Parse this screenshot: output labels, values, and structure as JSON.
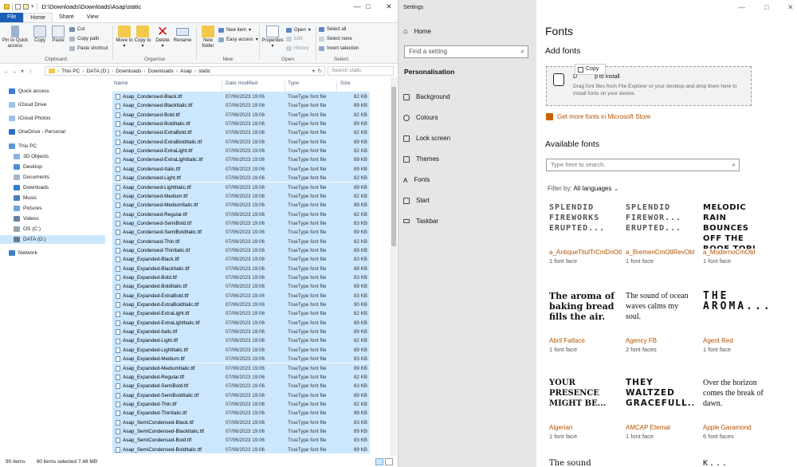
{
  "explorer": {
    "title": "D:\\Downloads\\Downloads\\Asap\\static",
    "tabs": [
      "File",
      "Home",
      "Share",
      "View"
    ],
    "ribbon": {
      "clipboard": {
        "label": "Clipboard",
        "pin": "Pin to Quick access",
        "copy": "Copy",
        "paste": "Paste",
        "cut": "Cut",
        "copy_path": "Copy path",
        "paste_shortcut": "Paste shortcut"
      },
      "organise": {
        "label": "Organise",
        "move_to": "Move to",
        "copy_to": "Copy to",
        "delete": "Delete",
        "rename": "Rename"
      },
      "new": {
        "label": "New",
        "new_folder": "New folder",
        "new_item": "New item",
        "easy_access": "Easy access"
      },
      "open": {
        "label": "Open",
        "properties": "Properties",
        "open": "Open",
        "edit": "Edit",
        "history": "History"
      },
      "select": {
        "label": "Select",
        "select_all": "Select all",
        "select_none": "Select none",
        "invert": "Invert selection"
      }
    },
    "breadcrumb": [
      "This PC",
      "DATA (D:)",
      "Downloads",
      "Downloads",
      "Asap",
      "static"
    ],
    "search_placeholder": "Search static",
    "nav": [
      "Quick access",
      "iCloud Drive",
      "iCloud Photos",
      "OneDrive - Personal",
      "This PC",
      "3D Objects",
      "Desktop",
      "Documents",
      "Downloads",
      "Music",
      "Pictures",
      "Videos",
      "OS (C:)",
      "DATA (D:)",
      "Network"
    ],
    "columns": {
      "name": "Name",
      "date": "Date modified",
      "type": "Type",
      "size": "Size"
    },
    "files": [
      {
        "name": "Asap_Condensed-Black.ttf",
        "date": "07/06/2023 19:06",
        "type": "TrueType font file",
        "size": "82 KB"
      },
      {
        "name": "Asap_Condensed-BlackItalic.ttf",
        "date": "07/06/2023 19:06",
        "type": "TrueType font file",
        "size": "89 KB"
      },
      {
        "name": "Asap_Condensed-Bold.ttf",
        "date": "07/06/2023 19:06",
        "type": "TrueType font file",
        "size": "82 KB"
      },
      {
        "name": "Asap_Condensed-BoldItalic.ttf",
        "date": "07/06/2023 19:06",
        "type": "TrueType font file",
        "size": "89 KB"
      },
      {
        "name": "Asap_Condensed-ExtraBold.ttf",
        "date": "07/06/2023 19:06",
        "type": "TrueType font file",
        "size": "82 KB"
      },
      {
        "name": "Asap_Condensed-ExtraBoldItalic.ttf",
        "date": "07/06/2023 19:06",
        "type": "TrueType font file",
        "size": "89 KB"
      },
      {
        "name": "Asap_Condensed-ExtraLight.ttf",
        "date": "07/06/2023 19:06",
        "type": "TrueType font file",
        "size": "82 KB"
      },
      {
        "name": "Asap_Condensed-ExtraLightItalic.ttf",
        "date": "07/06/2023 19:06",
        "type": "TrueType font file",
        "size": "89 KB"
      },
      {
        "name": "Asap_Condensed-Italic.ttf",
        "date": "07/06/2023 19:06",
        "type": "TrueType font file",
        "size": "89 KB"
      },
      {
        "name": "Asap_Condensed-Light.ttf",
        "date": "07/06/2023 19:06",
        "type": "TrueType font file",
        "size": "82 KB"
      },
      {
        "name": "Asap_Condensed-LightItalic.ttf",
        "date": "07/06/2023 19:06",
        "type": "TrueType font file",
        "size": "89 KB"
      },
      {
        "name": "Asap_Condensed-Medium.ttf",
        "date": "07/06/2023 19:06",
        "type": "TrueType font file",
        "size": "82 KB"
      },
      {
        "name": "Asap_Condensed-MediumItalic.ttf",
        "date": "07/06/2023 19:06",
        "type": "TrueType font file",
        "size": "89 KB"
      },
      {
        "name": "Asap_Condensed-Regular.ttf",
        "date": "07/06/2023 19:06",
        "type": "TrueType font file",
        "size": "82 KB"
      },
      {
        "name": "Asap_Condensed-SemiBold.ttf",
        "date": "07/06/2023 19:06",
        "type": "TrueType font file",
        "size": "83 KB"
      },
      {
        "name": "Asap_Condensed-SemiBoldItalic.ttf",
        "date": "07/06/2023 19:06",
        "type": "TrueType font file",
        "size": "89 KB"
      },
      {
        "name": "Asap_Condensed-Thin.ttf",
        "date": "07/06/2023 19:06",
        "type": "TrueType font file",
        "size": "82 KB"
      },
      {
        "name": "Asap_Condensed-ThinItalic.ttf",
        "date": "07/06/2023 19:06",
        "type": "TrueType font file",
        "size": "89 KB"
      },
      {
        "name": "Asap_Expanded-Black.ttf",
        "date": "07/06/2023 19:06",
        "type": "TrueType font file",
        "size": "83 KB"
      },
      {
        "name": "Asap_Expanded-BlackItalic.ttf",
        "date": "07/06/2023 19:06",
        "type": "TrueType font file",
        "size": "89 KB"
      },
      {
        "name": "Asap_Expanded-Bold.ttf",
        "date": "07/06/2023 19:06",
        "type": "TrueType font file",
        "size": "83 KB"
      },
      {
        "name": "Asap_Expanded-BoldItalic.ttf",
        "date": "07/06/2023 19:06",
        "type": "TrueType font file",
        "size": "89 KB"
      },
      {
        "name": "Asap_Expanded-ExtraBold.ttf",
        "date": "07/06/2023 19:06",
        "type": "TrueType font file",
        "size": "83 KB"
      },
      {
        "name": "Asap_Expanded-ExtraBoldItalic.ttf",
        "date": "07/06/2023 19:06",
        "type": "TrueType font file",
        "size": "90 KB"
      },
      {
        "name": "Asap_Expanded-ExtraLight.ttf",
        "date": "07/06/2023 19:06",
        "type": "TrueType font file",
        "size": "82 KB"
      },
      {
        "name": "Asap_Expanded-ExtraLightItalic.ttf",
        "date": "07/06/2023 19:06",
        "type": "TrueType font file",
        "size": "89 KB"
      },
      {
        "name": "Asap_Expanded-Italic.ttf",
        "date": "07/06/2023 19:06",
        "type": "TrueType font file",
        "size": "89 KB"
      },
      {
        "name": "Asap_Expanded-Light.ttf",
        "date": "07/06/2023 19:06",
        "type": "TrueType font file",
        "size": "82 KB"
      },
      {
        "name": "Asap_Expanded-LightItalic.ttf",
        "date": "07/06/2023 19:06",
        "type": "TrueType font file",
        "size": "89 KB"
      },
      {
        "name": "Asap_Expanded-Medium.ttf",
        "date": "07/06/2023 19:06",
        "type": "TrueType font file",
        "size": "83 KB"
      },
      {
        "name": "Asap_Expanded-MediumItalic.ttf",
        "date": "07/06/2023 19:06",
        "type": "TrueType font file",
        "size": "89 KB"
      },
      {
        "name": "Asap_Expanded-Regular.ttf",
        "date": "07/06/2023 19:06",
        "type": "TrueType font file",
        "size": "82 KB"
      },
      {
        "name": "Asap_Expanded-SemiBold.ttf",
        "date": "07/06/2023 19:06",
        "type": "TrueType font file",
        "size": "83 KB"
      },
      {
        "name": "Asap_Expanded-SemiBoldItalic.ttf",
        "date": "07/06/2023 19:06",
        "type": "TrueType font file",
        "size": "89 KB"
      },
      {
        "name": "Asap_Expanded-Thin.ttf",
        "date": "07/06/2023 19:06",
        "type": "TrueType font file",
        "size": "82 KB"
      },
      {
        "name": "Asap_Expanded-ThinItalic.ttf",
        "date": "07/06/2023 19:06",
        "type": "TrueType font file",
        "size": "89 KB"
      },
      {
        "name": "Asap_SemiCondensed-Black.ttf",
        "date": "07/06/2023 19:06",
        "type": "TrueType font file",
        "size": "83 KB"
      },
      {
        "name": "Asap_SemiCondensed-BlackItalic.ttf",
        "date": "07/06/2023 19:06",
        "type": "TrueType font file",
        "size": "89 KB"
      },
      {
        "name": "Asap_SemiCondensed-Bold.ttf",
        "date": "07/06/2023 19:06",
        "type": "TrueType font file",
        "size": "83 KB"
      },
      {
        "name": "Asap_SemiCondensed-BoldItalic.ttf",
        "date": "07/06/2023 19:06",
        "type": "TrueType font file",
        "size": "89 KB"
      }
    ],
    "status": {
      "count": "90 items",
      "selected": "90 items selected  7.48 MB"
    }
  },
  "settings": {
    "window_title": "Settings",
    "home": "Home",
    "search_placeholder": "Find a setting",
    "section": "Personalisation",
    "nav": [
      "Background",
      "Colours",
      "Lock screen",
      "Themes",
      "Fonts",
      "Start",
      "Taskbar"
    ],
    "page_title": "Fonts",
    "add_fonts": "Add fonts",
    "drop_title": "Drag and drop to install",
    "drop_title_visible": "D",
    "drop_title_tail": "p to install",
    "drop_desc": "Drag font files from File Explorer or your desktop and drop them here to install fonts on your device.",
    "copy_tooltip": "Copy",
    "store_link": "Get more fonts in Microsoft Store",
    "available": "Available fonts",
    "font_search_placeholder": "Type here to search.",
    "filter_label": "Filter by:",
    "filter_value": "All languages",
    "fonts": [
      {
        "preview": "SPLENDID FIREWORKS ERUPTED...",
        "name": "a_AntiqueTitulTrCmDnOtl",
        "faces": "1 font face"
      },
      {
        "preview": "SPLENDID FIREWOR... ERUPTED...",
        "name": "a_BremenCmOtlRevObl",
        "faces": "1 font face"
      },
      {
        "preview": "MELODIC RAIN BOUNCES OFF THE ROOF TOP!",
        "name": "a_ModernoCmObl",
        "faces": "1 font face"
      },
      {
        "preview": "The aroma of baking bread fills the air.",
        "name": "Abril Fatface",
        "faces": "1 font face"
      },
      {
        "preview": "The sound of ocean waves calms my soul.",
        "name": "Agency FB",
        "faces": "2 font faces"
      },
      {
        "preview": "THE AROMA...",
        "name": "Agent Red",
        "faces": "1 font face"
      },
      {
        "preview": "YOUR PRESENCE MIGHT BE...",
        "name": "Algerian",
        "faces": "1 font face"
      },
      {
        "preview": "THEY WALTZED GRACEFULL...",
        "name": "AMCAP Eternal",
        "faces": "1 font face"
      },
      {
        "preview": "Over the horizon comes the break of dawn.",
        "name": "Apple Garamond",
        "faces": "6 font faces"
      }
    ],
    "more_previews": [
      "The sound",
      "K..."
    ]
  },
  "colors": {
    "accent_orange": "#b35300",
    "selection": "#cce8ff",
    "file_tab": "#1a5fb4"
  }
}
